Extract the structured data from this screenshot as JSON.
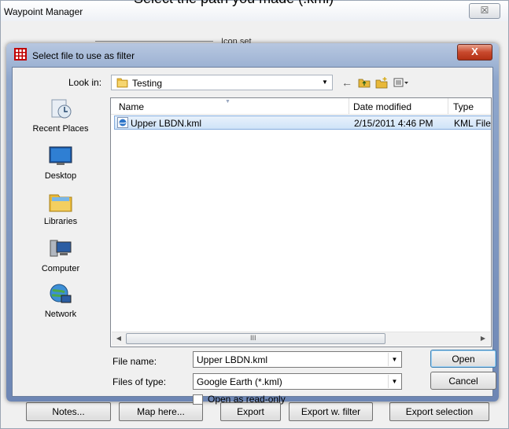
{
  "top_caption": "Select the path you made (.kml)",
  "background_window": {
    "title": "Waypoint Manager",
    "close_glyph": "☒",
    "group_label": "Icon set",
    "buttons": [
      "Notes...",
      "Map here...",
      "Export",
      "Export w. filter",
      "Export selection"
    ]
  },
  "dialog": {
    "title": "Select file to use as filter",
    "close_glyph": "X",
    "look_in_label": "Look in:",
    "look_in_value": "Testing",
    "places": [
      "Recent Places",
      "Desktop",
      "Libraries",
      "Computer",
      "Network"
    ],
    "columns": [
      "Name",
      "Date modified",
      "Type"
    ],
    "files": [
      {
        "name": "Upper LBDN.kml",
        "date_modified": "2/15/2011 4:46 PM",
        "type": "KML File",
        "icon": "google-earth-file-icon"
      }
    ],
    "scroll_grip": "III",
    "file_name_label": "File name:",
    "file_name_value": "Upper LBDN.kml",
    "files_of_type_label": "Files of type:",
    "files_of_type_value": "Google Earth (*.kml)",
    "read_only_label": "Open as read-only",
    "open_button": "Open",
    "cancel_button": "Cancel"
  }
}
